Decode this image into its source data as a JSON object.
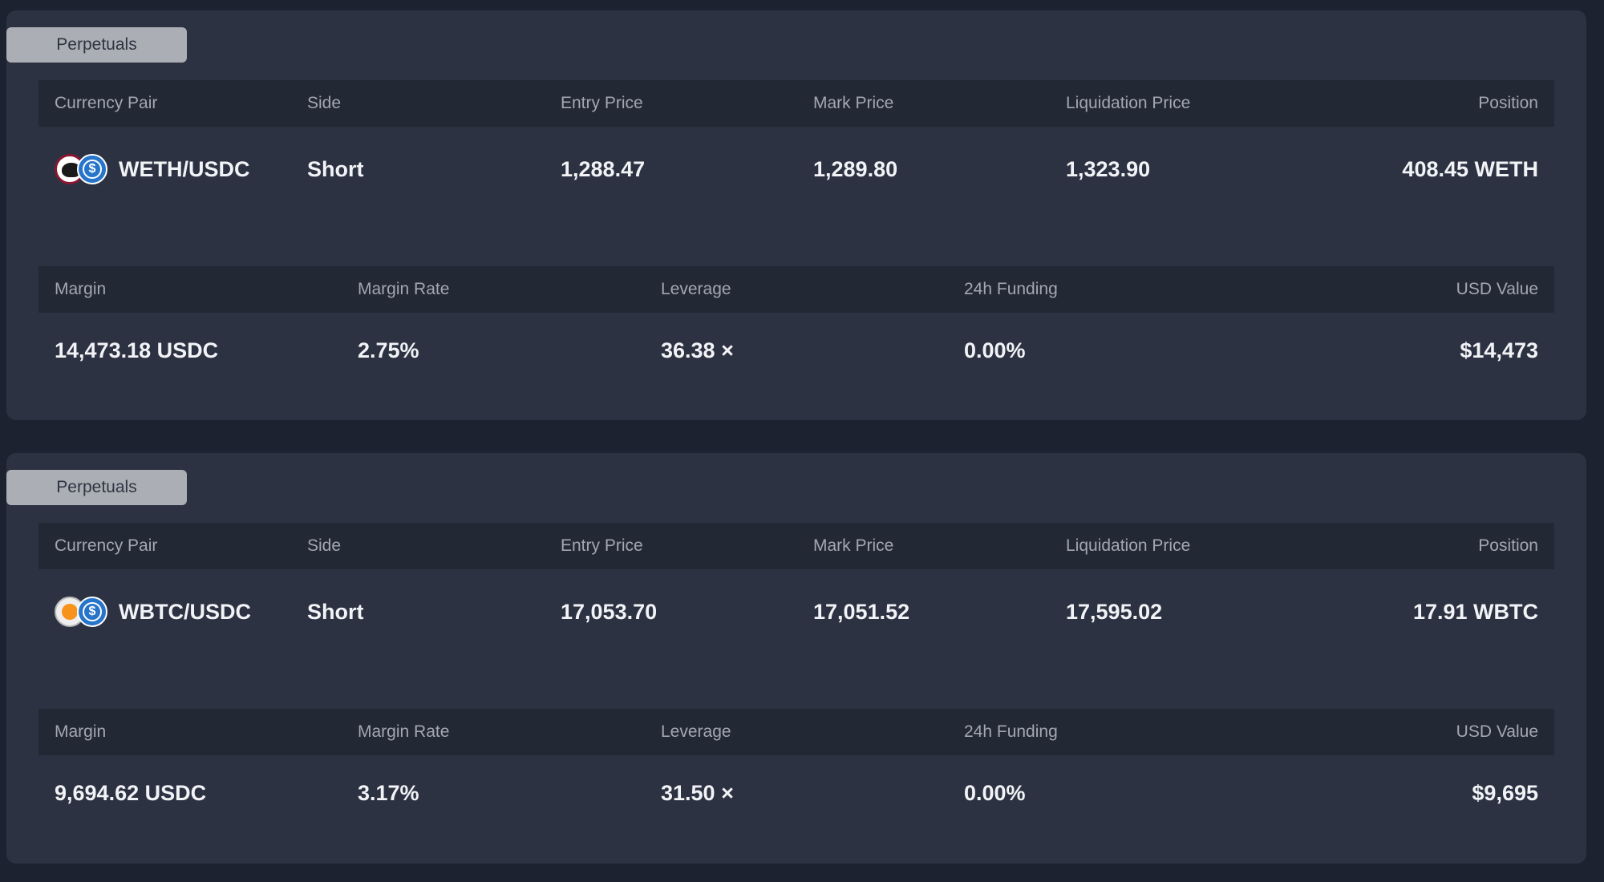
{
  "headers": {
    "currency_pair": "Currency Pair",
    "side": "Side",
    "entry_price": "Entry Price",
    "mark_price": "Mark Price",
    "liquidation_price": "Liquidation Price",
    "position": "Position",
    "margin": "Margin",
    "margin_rate": "Margin Rate",
    "leverage": "Leverage",
    "funding_24h": "24h Funding",
    "usd_value": "USD Value"
  },
  "positions": [
    {
      "tag": "Perpetuals",
      "pair": "WETH/USDC",
      "base_icon": "weth-icon",
      "quote_icon": "usdc-icon",
      "side": "Short",
      "entry_price": "1,288.47",
      "mark_price": "1,289.80",
      "liquidation_price": "1,323.90",
      "position": "408.45 WETH",
      "margin": "14,473.18 USDC",
      "margin_rate": "2.75%",
      "leverage": "36.38 ×",
      "funding_24h": "0.00%",
      "usd_value": "$14,473"
    },
    {
      "tag": "Perpetuals",
      "pair": "WBTC/USDC",
      "base_icon": "wbtc-icon",
      "quote_icon": "usdc-icon",
      "side": "Short",
      "entry_price": "17,053.70",
      "mark_price": "17,051.52",
      "liquidation_price": "17,595.02",
      "position": "17.91 WBTC",
      "margin": "9,694.62 USDC",
      "margin_rate": "3.17%",
      "leverage": "31.50 ×",
      "funding_24h": "0.00%",
      "usd_value": "$9,695"
    }
  ],
  "colors": {
    "page_bg": "#1d2230",
    "panel_bg": "#2d3242",
    "header_bg": "#232835",
    "tag_bg": "#abaeb4",
    "usdc_blue": "#2775ca",
    "btc_orange": "#f7931a",
    "weth_red": "#8a1630"
  }
}
